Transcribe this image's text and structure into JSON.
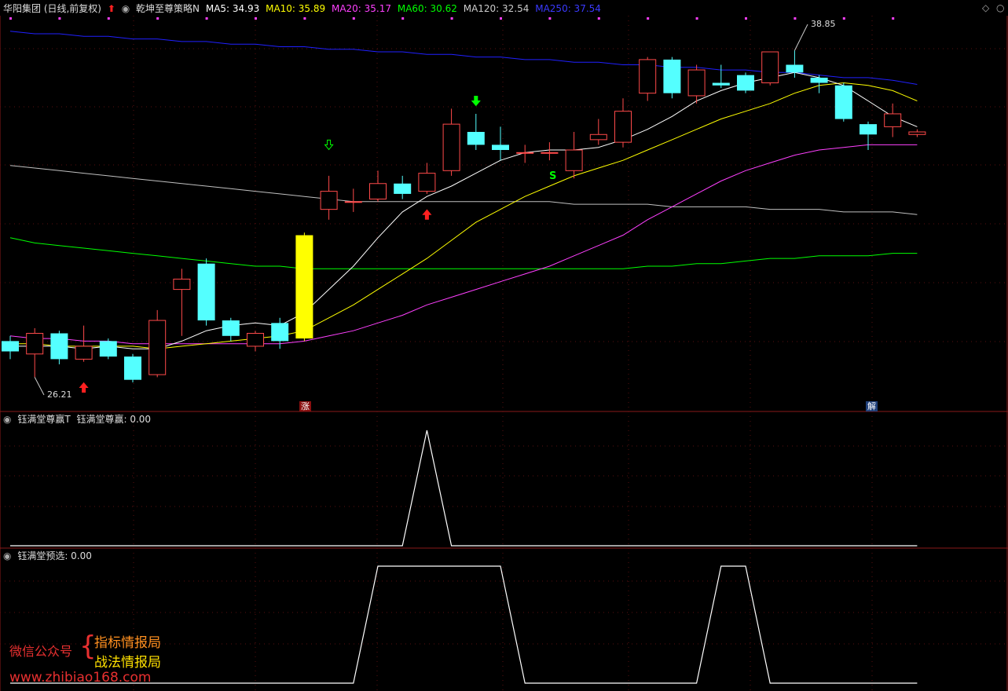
{
  "header": {
    "stock": "华阳集团 (日线,前复权)",
    "strategy": "乾坤至尊策略N",
    "ma5": "MA5: 34.93",
    "ma10": "MA10: 35.89",
    "ma20": "MA20: 35.17",
    "ma60": "MA60: 30.62",
    "ma120": "MA120: 32.54",
    "ma250": "MA250: 37.54",
    "colors": {
      "ma5": "#ffffff",
      "ma10": "#ffff00",
      "ma20": "#ff40ff",
      "ma60": "#00ff00",
      "ma120": "#c0c0c0",
      "ma250": "#2020ff"
    }
  },
  "price_labels": {
    "high": "38.85",
    "low": "26.21"
  },
  "tags": {
    "zhang": "涨",
    "jie": "解"
  },
  "signals": {
    "s": "S"
  },
  "panel2": {
    "title": "钰满堂尊赢T",
    "value": "钰满堂尊赢: 0.00"
  },
  "panel3": {
    "title": "钰满堂预选: 0.00"
  },
  "watermark": {
    "wechat": "微信公众号",
    "brace": "{",
    "line1": "指标情报局",
    "line2": "战法情报局",
    "url": "www.zhibiao168.com"
  },
  "chart_data": {
    "type": "candlestick",
    "candles": [
      {
        "o": 27.6,
        "c": 27.2,
        "h": 27.8,
        "l": 26.9
      },
      {
        "o": 27.1,
        "c": 27.9,
        "h": 28.1,
        "l": 26.2
      },
      {
        "o": 27.9,
        "c": 26.9,
        "h": 28.0,
        "l": 26.7
      },
      {
        "o": 26.9,
        "c": 27.4,
        "h": 28.2,
        "l": 26.8
      },
      {
        "o": 27.6,
        "c": 27.0,
        "h": 27.7,
        "l": 26.9
      },
      {
        "o": 27.0,
        "c": 26.1,
        "h": 27.1,
        "l": 26.0
      },
      {
        "o": 26.3,
        "c": 28.4,
        "h": 28.8,
        "l": 26.2
      },
      {
        "o": 29.6,
        "c": 30.0,
        "h": 30.4,
        "l": 27.8
      },
      {
        "o": 30.6,
        "c": 28.4,
        "h": 30.8,
        "l": 28.2
      },
      {
        "o": 28.4,
        "c": 27.8,
        "h": 28.5,
        "l": 27.6
      },
      {
        "o": 27.4,
        "c": 27.9,
        "h": 28.0,
        "l": 27.2
      },
      {
        "o": 28.3,
        "c": 27.6,
        "h": 28.5,
        "l": 27.3
      },
      {
        "o": 27.7,
        "c": 31.7,
        "h": 31.8,
        "l": 27.6
      },
      {
        "o": 32.7,
        "c": 33.4,
        "h": 34.0,
        "l": 32.3
      },
      {
        "o": 33.0,
        "c": 33.0,
        "h": 33.5,
        "l": 32.6
      },
      {
        "o": 33.1,
        "c": 33.7,
        "h": 34.2,
        "l": 33.0
      },
      {
        "o": 33.7,
        "c": 33.3,
        "h": 34.0,
        "l": 33.1
      },
      {
        "o": 33.4,
        "c": 34.1,
        "h": 34.5,
        "l": 33.3
      },
      {
        "o": 34.2,
        "c": 36.0,
        "h": 36.6,
        "l": 34.0
      },
      {
        "o": 35.7,
        "c": 35.2,
        "h": 36.4,
        "l": 35.0
      },
      {
        "o": 35.2,
        "c": 35.0,
        "h": 35.9,
        "l": 34.6
      },
      {
        "o": 34.9,
        "c": 34.9,
        "h": 35.2,
        "l": 34.5
      },
      {
        "o": 34.9,
        "c": 34.9,
        "h": 35.3,
        "l": 34.6
      },
      {
        "o": 34.2,
        "c": 35.0,
        "h": 35.7,
        "l": 33.9
      },
      {
        "o": 35.4,
        "c": 35.6,
        "h": 36.2,
        "l": 35.2
      },
      {
        "o": 35.3,
        "c": 36.5,
        "h": 37.0,
        "l": 35.1
      },
      {
        "o": 37.2,
        "c": 38.5,
        "h": 38.6,
        "l": 36.9
      },
      {
        "o": 38.5,
        "c": 37.2,
        "h": 38.6,
        "l": 37.0
      },
      {
        "o": 37.1,
        "c": 38.1,
        "h": 38.3,
        "l": 36.8
      },
      {
        "o": 37.6,
        "c": 37.5,
        "h": 38.3,
        "l": 37.4
      },
      {
        "o": 37.9,
        "c": 37.3,
        "h": 38.0,
        "l": 37.2
      },
      {
        "o": 37.6,
        "c": 38.8,
        "h": 38.8,
        "l": 37.5
      },
      {
        "o": 38.3,
        "c": 38.0,
        "h": 38.85,
        "l": 37.8
      },
      {
        "o": 37.8,
        "c": 37.6,
        "h": 37.9,
        "l": 37.2
      },
      {
        "o": 37.5,
        "c": 36.2,
        "h": 37.6,
        "l": 36.1
      },
      {
        "o": 36.0,
        "c": 35.6,
        "h": 36.1,
        "l": 35.0
      },
      {
        "o": 35.9,
        "c": 36.4,
        "h": 36.8,
        "l": 35.5
      },
      {
        "o": 35.6,
        "c": 35.7,
        "h": 35.8,
        "l": 35.5
      }
    ],
    "highlight_index": 12,
    "ma5": [
      27.4,
      27.4,
      27.4,
      27.3,
      27.4,
      27.3,
      27.3,
      27.6,
      28.0,
      28.2,
      28.3,
      28.2,
      28.7,
      29.6,
      30.5,
      31.6,
      32.6,
      33.2,
      33.6,
      34.1,
      34.6,
      34.9,
      35.0,
      35.0,
      35.1,
      35.4,
      35.8,
      36.3,
      36.9,
      37.3,
      37.6,
      37.8,
      38.0,
      37.8,
      37.5,
      36.9,
      36.3,
      35.9
    ],
    "ma10": [
      27.5,
      27.5,
      27.4,
      27.4,
      27.4,
      27.4,
      27.3,
      27.4,
      27.5,
      27.6,
      27.7,
      27.8,
      28.0,
      28.5,
      29.0,
      29.6,
      30.2,
      30.8,
      31.5,
      32.2,
      32.7,
      33.2,
      33.6,
      34.0,
      34.3,
      34.6,
      35.0,
      35.4,
      35.8,
      36.2,
      36.5,
      36.8,
      37.2,
      37.5,
      37.6,
      37.5,
      37.3,
      36.9
    ],
    "ma20": [
      27.8,
      27.7,
      27.7,
      27.6,
      27.6,
      27.5,
      27.5,
      27.5,
      27.5,
      27.5,
      27.5,
      27.5,
      27.6,
      27.8,
      28.0,
      28.3,
      28.6,
      29.0,
      29.3,
      29.6,
      29.9,
      30.2,
      30.5,
      30.9,
      31.3,
      31.7,
      32.3,
      32.8,
      33.3,
      33.8,
      34.2,
      34.5,
      34.8,
      35.0,
      35.1,
      35.2,
      35.2,
      35.2
    ],
    "ma60": [
      31.6,
      31.4,
      31.3,
      31.2,
      31.1,
      31.0,
      30.9,
      30.8,
      30.7,
      30.6,
      30.5,
      30.5,
      30.4,
      30.4,
      30.4,
      30.4,
      30.4,
      30.4,
      30.4,
      30.4,
      30.4,
      30.4,
      30.4,
      30.4,
      30.4,
      30.4,
      30.5,
      30.5,
      30.6,
      30.6,
      30.7,
      30.8,
      30.8,
      30.9,
      30.9,
      30.9,
      31.0,
      31.0
    ],
    "ma120": [
      34.4,
      34.3,
      34.2,
      34.1,
      34.0,
      33.9,
      33.8,
      33.7,
      33.6,
      33.5,
      33.4,
      33.3,
      33.2,
      33.1,
      33.0,
      33.0,
      33.0,
      33.0,
      33.0,
      33.0,
      33.0,
      33.0,
      33.0,
      32.9,
      32.9,
      32.9,
      32.9,
      32.8,
      32.8,
      32.8,
      32.8,
      32.7,
      32.7,
      32.7,
      32.6,
      32.6,
      32.6,
      32.5
    ],
    "ma250": [
      39.6,
      39.5,
      39.5,
      39.4,
      39.4,
      39.3,
      39.3,
      39.2,
      39.2,
      39.1,
      39.1,
      39.0,
      39.0,
      38.9,
      38.9,
      38.8,
      38.8,
      38.7,
      38.7,
      38.6,
      38.6,
      38.5,
      38.5,
      38.4,
      38.4,
      38.3,
      38.3,
      38.2,
      38.2,
      38.1,
      38.1,
      38.0,
      38.0,
      37.9,
      37.8,
      37.8,
      37.7,
      37.54
    ],
    "panel2_series": [
      0,
      0,
      0,
      0,
      0,
      0,
      0,
      0,
      0,
      0,
      0,
      0,
      0,
      0,
      0,
      0,
      0,
      1,
      0,
      0,
      0,
      0,
      0,
      0,
      0,
      0,
      0,
      0,
      0,
      0,
      0,
      0,
      0,
      0,
      0,
      0,
      0,
      0
    ],
    "panel3_series": [
      0,
      0,
      0,
      0,
      0,
      0,
      0,
      0,
      0,
      0,
      0,
      0,
      0,
      0,
      0,
      1,
      1,
      1,
      1,
      1,
      1,
      0,
      0,
      0,
      0,
      0,
      0,
      0,
      0,
      1,
      1,
      0,
      0,
      0,
      0,
      0,
      0,
      0
    ]
  }
}
